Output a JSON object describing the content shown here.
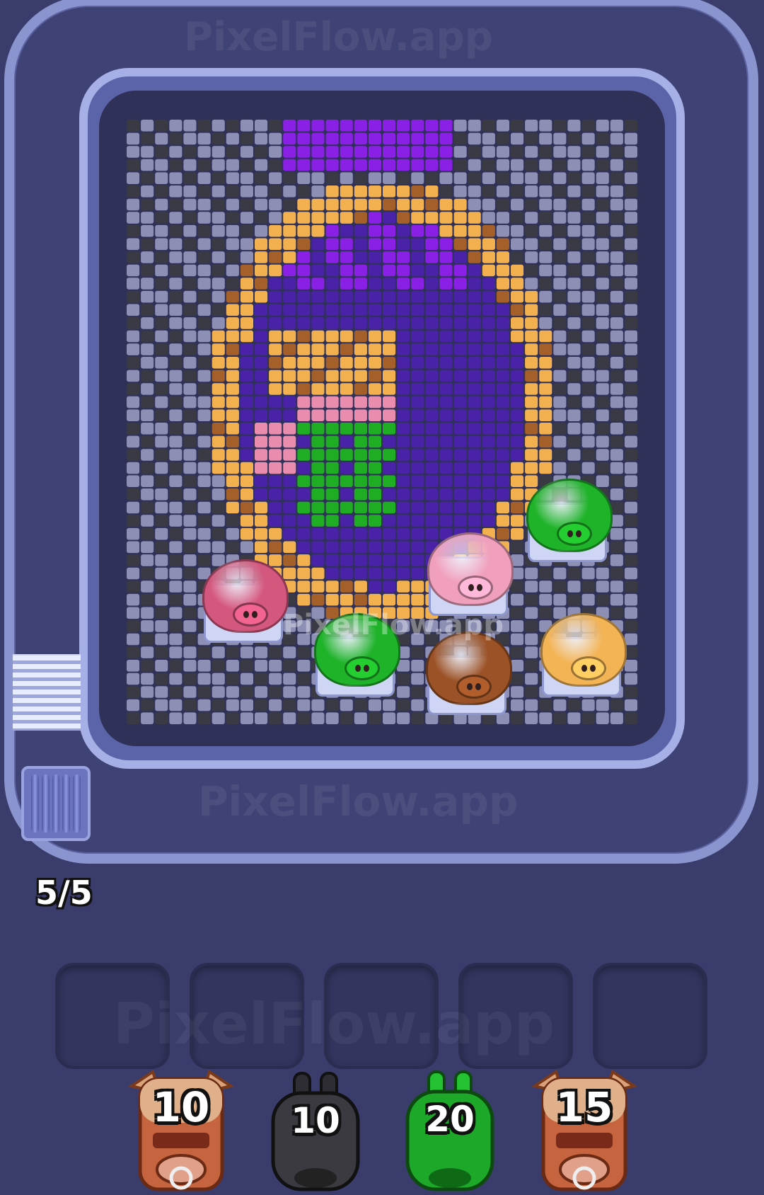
{
  "game": {
    "watermark": "PixelFlow.app",
    "conveyor_counter": "5/5",
    "colors": {
      "purple": "#8a1fe6",
      "dark_purple": "#4a22a8",
      "orange": "#f2b14e",
      "brown": "#a5602a",
      "gray": "#8d8fb5",
      "dark": "#3a3a44",
      "pink": "#e98cae",
      "green": "#1fae23"
    },
    "board_pigs": [
      {
        "color": "green-pig",
        "tint": "#1fb32a"
      },
      {
        "color": "pink-pig",
        "tint": "#f0a0bd"
      },
      {
        "color": "magenta-pig",
        "tint": "#d4577e"
      },
      {
        "color": "green-pig",
        "tint": "#1fb32a"
      },
      {
        "color": "brown-pig",
        "tint": "#9b5226"
      },
      {
        "color": "orange-pig",
        "tint": "#f3b456"
      }
    ],
    "empty_slots": 5,
    "queue": [
      {
        "label": "10",
        "type": "brown-cow-shooter",
        "tint": "#c5643e"
      },
      {
        "label": "10",
        "type": "black-bunny-shooter",
        "tint": "#3a3a40"
      },
      {
        "label": "20",
        "type": "green-bunny-shooter",
        "tint": "#1ea82a"
      },
      {
        "label": "15",
        "type": "brown-cow-shooter",
        "tint": "#c5643e"
      }
    ]
  }
}
